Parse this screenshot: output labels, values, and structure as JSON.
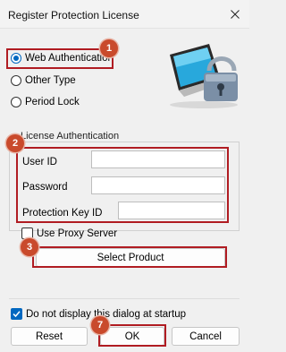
{
  "window": {
    "title": "Register Protection License"
  },
  "auth_type": {
    "options": [
      {
        "label": "Web Authentication",
        "selected": true
      },
      {
        "label": "Other Type",
        "selected": false
      },
      {
        "label": "Period Lock",
        "selected": false
      }
    ]
  },
  "license_auth": {
    "group_label": "License Authentication",
    "fields": [
      {
        "label": "User ID",
        "value": ""
      },
      {
        "label": "Password",
        "value": ""
      },
      {
        "label": "Protection Key ID",
        "value": ""
      }
    ]
  },
  "proxy": {
    "label": "Use Proxy Server",
    "checked": false
  },
  "select_product": {
    "label": "Select Product"
  },
  "startup": {
    "label": "Do not display this dialog at startup",
    "checked": true
  },
  "footer": {
    "reset_label": "Reset",
    "ok_label": "OK",
    "cancel_label": "Cancel"
  },
  "callouts": [
    "1",
    "2",
    "3",
    "7"
  ],
  "colors": {
    "accent": "#0067c0",
    "highlight": "#b01c22",
    "badge": "#c94a2c"
  }
}
